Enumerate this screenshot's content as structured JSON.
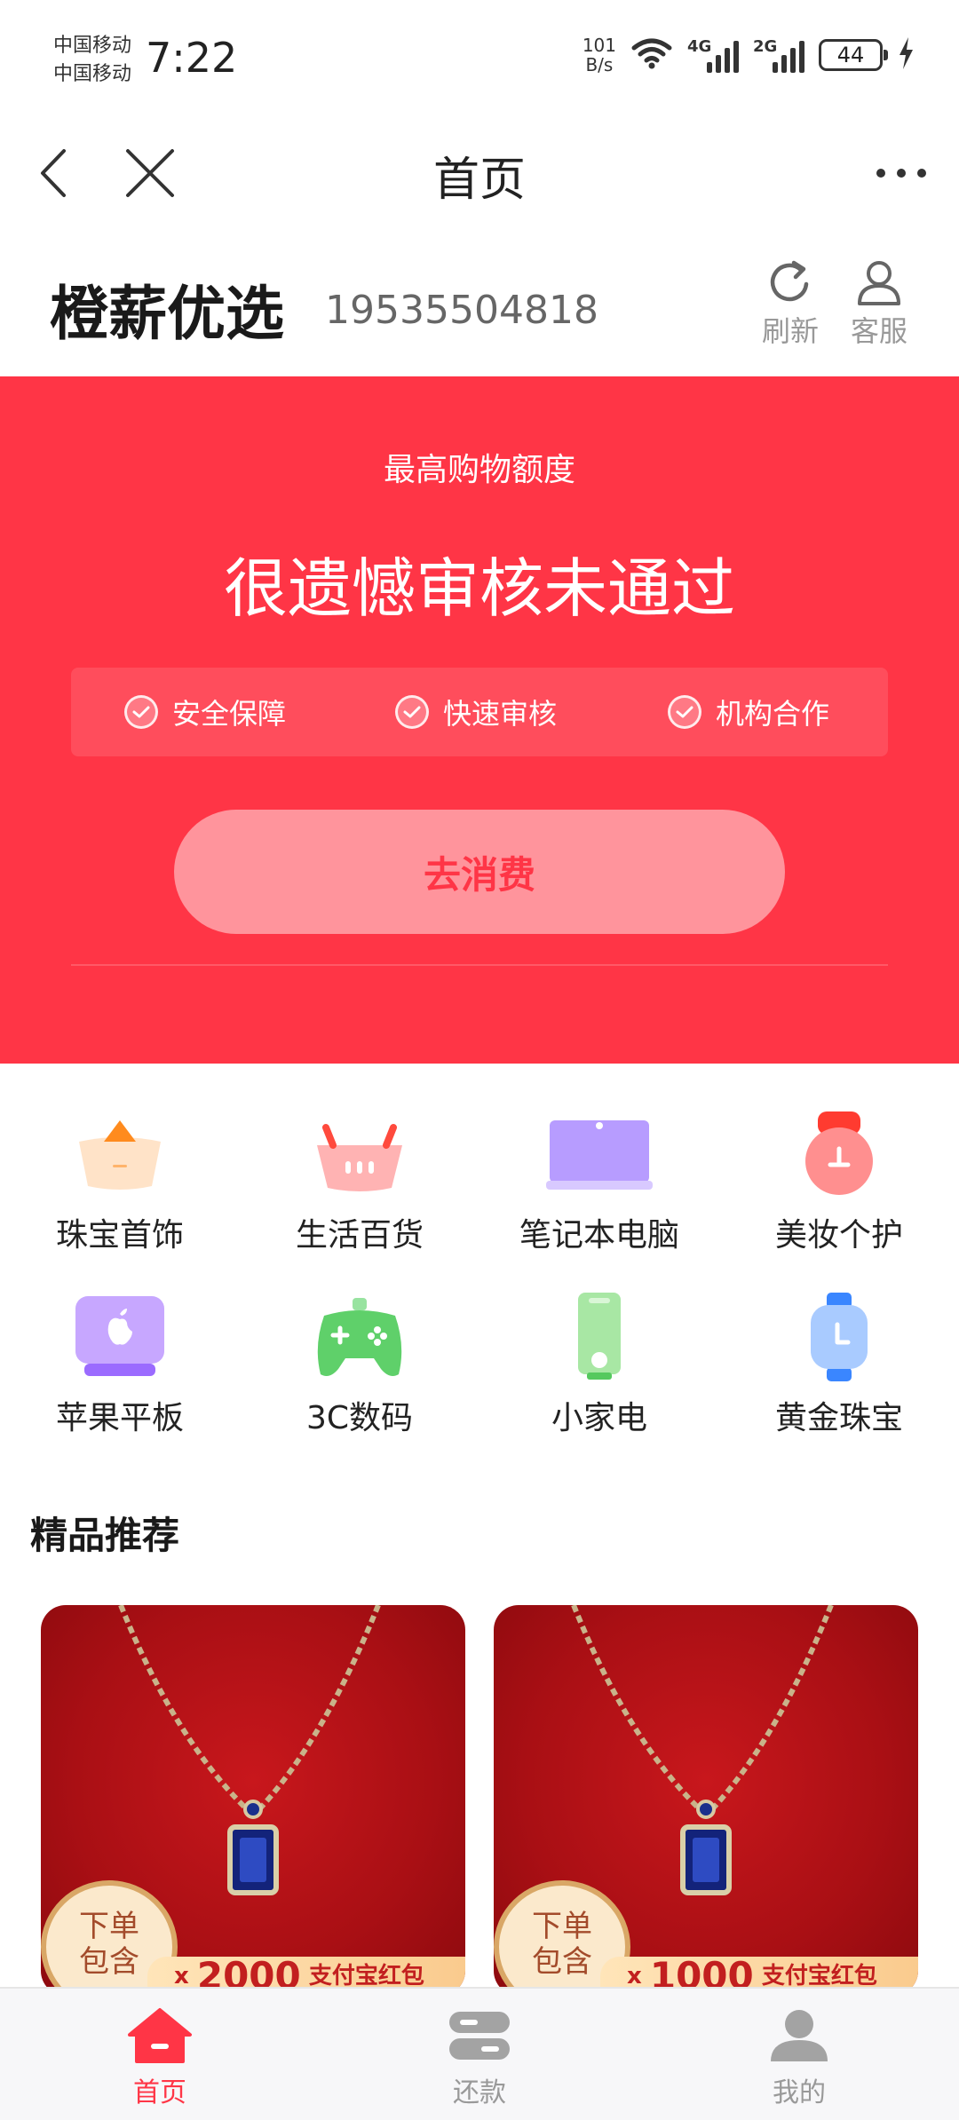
{
  "status_bar": {
    "carrier_1": "中国移动",
    "carrier_2": "中国移动",
    "time": "7:22",
    "speed_value": "101",
    "speed_unit": "B/s",
    "net_1": "4G",
    "net_2": "2G",
    "battery": "44"
  },
  "nav": {
    "title": "首页"
  },
  "header": {
    "brand": "橙薪优选",
    "phone": "19535504818",
    "refresh_label": "刷新",
    "service_label": "客服"
  },
  "banner": {
    "subtitle": "最高购物额度",
    "message": "很遗憾审核未通过",
    "features": [
      "安全保障",
      "快速审核",
      "机构合作"
    ],
    "cta": "去消费",
    "color": "#ff3546"
  },
  "categories": [
    {
      "label": "珠宝首饰",
      "icon": "gold-ingot-icon"
    },
    {
      "label": "生活百货",
      "icon": "shopping-basket-icon"
    },
    {
      "label": "笔记本电脑",
      "icon": "laptop-icon"
    },
    {
      "label": "美妆个护",
      "icon": "cosmetics-icon"
    },
    {
      "label": "苹果平板",
      "icon": "apple-tablet-icon"
    },
    {
      "label": "3C数码",
      "icon": "gamepad-icon"
    },
    {
      "label": "小家电",
      "icon": "small-appliance-icon"
    },
    {
      "label": "黄金珠宝",
      "icon": "watch-icon"
    }
  ],
  "section": {
    "title": "精品推荐"
  },
  "products": [
    {
      "badge_line1": "下单",
      "badge_line2": "包含",
      "ribbon_prefix": "x",
      "ribbon_amount": "2000",
      "ribbon_text": "支付宝红包"
    },
    {
      "badge_line1": "下单",
      "badge_line2": "包含",
      "ribbon_prefix": "x",
      "ribbon_amount": "1000",
      "ribbon_text": "支付宝红包"
    }
  ],
  "tabs": [
    {
      "label": "首页",
      "icon": "home-icon",
      "active": true
    },
    {
      "label": "还款",
      "icon": "repay-icon",
      "active": false
    },
    {
      "label": "我的",
      "icon": "user-icon",
      "active": false
    }
  ]
}
